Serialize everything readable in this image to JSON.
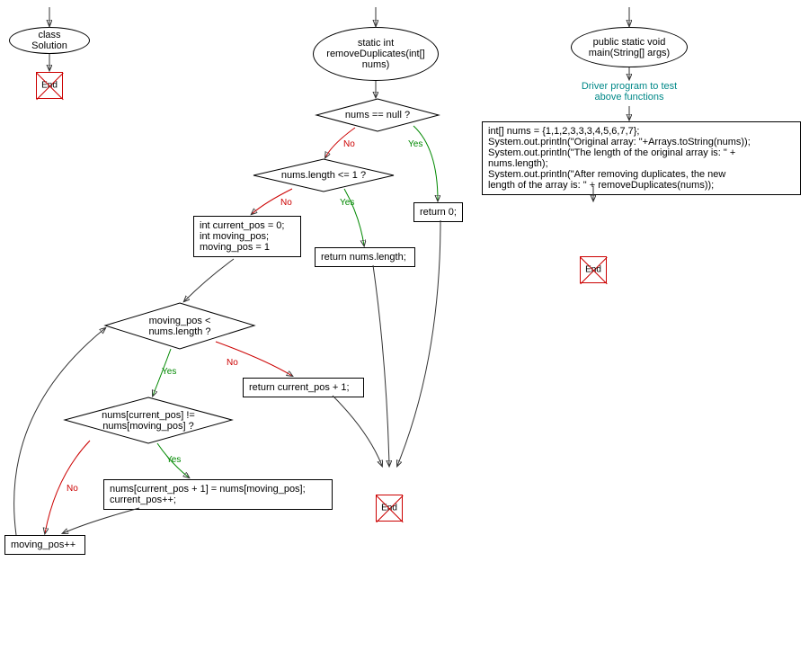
{
  "left": {
    "title": "class Solution",
    "end": "End"
  },
  "middle": {
    "funcTitle": "static int removeDuplicates(int[] nums)",
    "dec1": "nums == null ?",
    "dec2": "nums.length <= 1 ?",
    "dec3": "moving_pos < nums.length ?",
    "dec4": "nums[current_pos] != nums[moving_pos] ?",
    "box1": "int current_pos = 0;\nint moving_pos;\nmoving_pos = 1",
    "box2": "return nums.length;",
    "box3": "return 0;",
    "box4": "return current_pos + 1;",
    "box5": "nums[current_pos + 1] = nums[moving_pos];\ncurrent_pos++;",
    "box6": "moving_pos++",
    "yes": "Yes",
    "no": "No",
    "end": "End"
  },
  "right": {
    "funcTitle": "public static void main(String[] args)",
    "comment": "Driver program to test above functions",
    "body": "int[] nums = {1,1,2,3,3,3,4,5,6,7,7};\nSystem.out.println(\"Original array: \"+Arrays.toString(nums));\nSystem.out.println(\"The length of the original array is: \" + nums.length);\nSystem.out.println(\"After removing duplicates, the new\nlength of the array is: \" + removeDuplicates(nums));",
    "end": "End"
  }
}
